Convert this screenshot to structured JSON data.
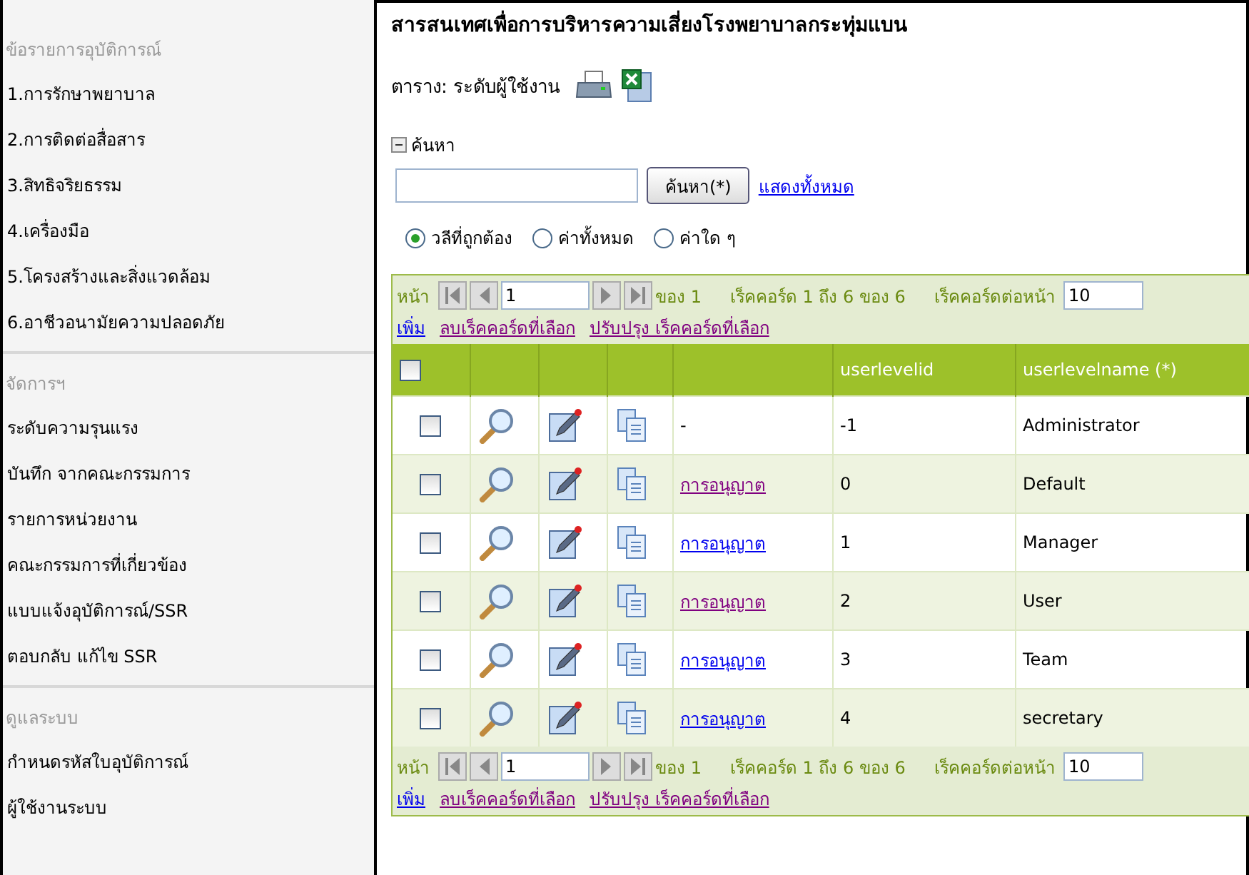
{
  "sidebar": {
    "sections": [
      {
        "title": "ข้อรายการอุบัติการณ์",
        "items": [
          "1.การรักษาพยาบาล",
          "2.การติดต่อสื่อสาร",
          "3.สิทธิจริยธรรม",
          "4.เครื่องมือ",
          "5.โครงสร้างและสิ่งแวดล้อม",
          "6.อาชีวอนามัยความปลอดภัย"
        ]
      },
      {
        "title": "จัดการฯ",
        "items": [
          "ระดับความรุนแรง",
          "บันทึก จากคณะกรรมการ",
          "รายการหน่วยงาน",
          "คณะกรรมการที่เกี่ยวข้อง",
          "แบบแจ้งอุบัติการณ์/SSR",
          "ตอบกลับ แก้ไข SSR"
        ]
      },
      {
        "title": "ดูแลระบบ",
        "items": [
          "กำหนดรหัสใบอุบัติการณ์",
          "ผู้ใช้งานระบบ"
        ]
      }
    ]
  },
  "page": {
    "title": "สารสนเทศเพื่อการบริหารความเสี่ยงโรงพยาบาลกระทุ่มแบน",
    "caption": "ตาราง: ระดับผู้ใช้งาน",
    "search": {
      "toggle": "ค้นหา",
      "expanded": true,
      "button": "ค้นหา(*)",
      "show_all": "แสดงทั้งหมด",
      "radios": [
        {
          "label": "วลีที่ถูกต้อง",
          "selected": true
        },
        {
          "label": "ค่าทั้งหมด",
          "selected": false
        },
        {
          "label": "ค่าใด ๆ",
          "selected": false
        }
      ]
    }
  },
  "pager_top": {
    "page_label": "หน้า",
    "page": "1",
    "of": "ของ 1",
    "records": "เร็คคอร์ด 1 ถึง 6 ของ 6",
    "per_page_label": "เร็คคอร์ดต่อหน้า",
    "per_page": "10",
    "actions": [
      {
        "label": "เพิ่ม",
        "visited": false
      },
      {
        "label": "ลบเร็คคอร์ดที่เลือก",
        "visited": true
      },
      {
        "label": "ปรับปรุง เร็คคอร์ดที่เลือก",
        "visited": true
      }
    ]
  },
  "table": {
    "header_checked": false,
    "columns": [
      "userlevelid",
      "userlevelname (*)"
    ],
    "rows": [
      {
        "checked": false,
        "permission": {
          "kind": "text",
          "label": "-"
        },
        "id": "-1",
        "name": "Administrator"
      },
      {
        "checked": false,
        "permission": {
          "kind": "link",
          "label": "การอนุญาต",
          "visited": true
        },
        "id": "0",
        "name": "Default"
      },
      {
        "checked": false,
        "permission": {
          "kind": "link",
          "label": "การอนุญาต",
          "visited": false
        },
        "id": "1",
        "name": "Manager"
      },
      {
        "checked": false,
        "permission": {
          "kind": "link",
          "label": "การอนุญาต",
          "visited": true
        },
        "id": "2",
        "name": "User"
      },
      {
        "checked": false,
        "permission": {
          "kind": "link",
          "label": "การอนุญาต",
          "visited": false
        },
        "id": "3",
        "name": "Team"
      },
      {
        "checked": false,
        "permission": {
          "kind": "link",
          "label": "การอนุญาต",
          "visited": false
        },
        "id": "4",
        "name": "secretary"
      }
    ]
  },
  "pager_bottom": {
    "page_label": "หน้า",
    "page": "1",
    "of": "ของ 1",
    "records": "เร็คคอร์ด 1 ถึง 6 ของ 6",
    "per_page_label": "เร็คคอร์ดต่อหน้า",
    "per_page": "10",
    "actions": [
      {
        "label": "เพิ่ม",
        "visited": false
      },
      {
        "label": "ลบเร็คคอร์ดที่เลือก",
        "visited": true
      },
      {
        "label": "ปรับปรุง เร็คคอร์ดที่เลือก",
        "visited": true
      }
    ]
  }
}
